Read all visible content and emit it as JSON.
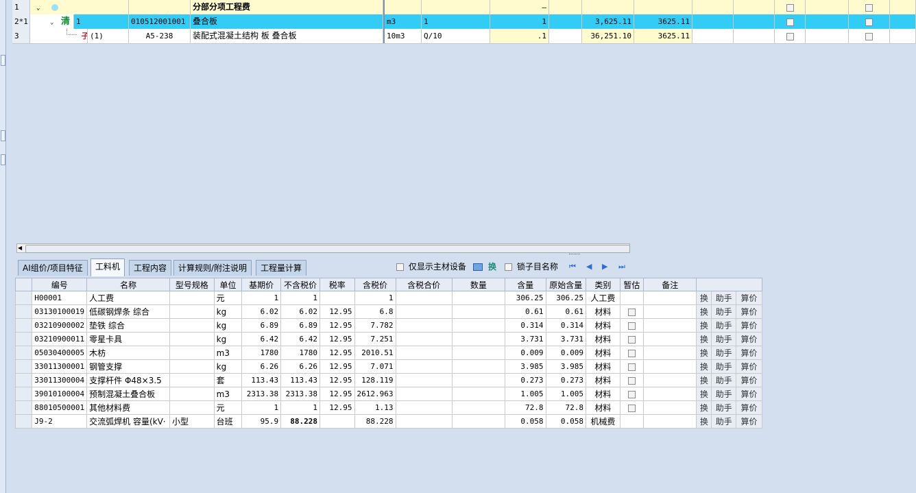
{
  "top_rows": [
    {
      "row": "1",
      "code": "",
      "name": "分部分项工程费",
      "unit": "",
      "expr": "",
      "qty": "–",
      "price": "",
      "total": ""
    },
    {
      "row": "2*1",
      "type": "清",
      "idx": "1",
      "code": "010512001001",
      "name": "叠合板",
      "unit": "m3",
      "expr": "1",
      "qty": "1",
      "price": "3,625.11",
      "total": "3625.11"
    },
    {
      "row": "3",
      "type": "子",
      "idx": "(1)",
      "code": "A5-238",
      "name": "装配式混凝土结构 板 叠合板",
      "unit": "10m3",
      "expr": "Q/10",
      "qty": ".1",
      "price": "36,251.10",
      "total": "3625.11"
    }
  ],
  "tabs": [
    "AI组价/项目特征",
    "工料机",
    "工程内容",
    "计算规则/附注说明",
    "工程量计算"
  ],
  "active_tab": 1,
  "toolbar": {
    "only_main_label": "仅显示主材设备",
    "swap_label": "换",
    "lock_name_label": "锁子目名称"
  },
  "columns": [
    "编号",
    "名称",
    "型号规格",
    "单位",
    "基期价",
    "不含税价",
    "税率",
    "含税价",
    "含税合价",
    "数量",
    "含量",
    "原始含量",
    "类别",
    "暂估",
    "备注"
  ],
  "row_buttons": [
    "换",
    "助手",
    "算价"
  ],
  "items": [
    {
      "code": "H00001",
      "name": "人工费",
      "spec": "",
      "unit": "元",
      "base": "1",
      "notax": "1",
      "tax": "",
      "withtax": "1",
      "content": "306.25",
      "orig": "306.25",
      "cat": "人工费",
      "est": false
    },
    {
      "code": "03130100019",
      "name": "低碳钢焊条 综合",
      "spec": "",
      "unit": "kg",
      "base": "6.02",
      "notax": "6.02",
      "tax": "12.95",
      "withtax": "6.8",
      "content": "0.61",
      "orig": "0.61",
      "cat": "材料",
      "est": true
    },
    {
      "code": "03210900002",
      "name": "垫铁 综合",
      "spec": "",
      "unit": "kg",
      "base": "6.89",
      "notax": "6.89",
      "tax": "12.95",
      "withtax": "7.782",
      "content": "0.314",
      "orig": "0.314",
      "cat": "材料",
      "est": true
    },
    {
      "code": "03210900011",
      "name": "零星卡具",
      "spec": "",
      "unit": "kg",
      "base": "6.42",
      "notax": "6.42",
      "tax": "12.95",
      "withtax": "7.251",
      "content": "3.731",
      "orig": "3.731",
      "cat": "材料",
      "est": true
    },
    {
      "code": "05030400005",
      "name": "木枋",
      "spec": "",
      "unit": "m3",
      "base": "1780",
      "notax": "1780",
      "tax": "12.95",
      "withtax": "2010.51",
      "content": "0.009",
      "orig": "0.009",
      "cat": "材料",
      "est": true
    },
    {
      "code": "33011300001",
      "name": "钢管支撑",
      "spec": "",
      "unit": "kg",
      "base": "6.26",
      "notax": "6.26",
      "tax": "12.95",
      "withtax": "7.071",
      "content": "3.985",
      "orig": "3.985",
      "cat": "材料",
      "est": true
    },
    {
      "code": "33011300004",
      "name": "支撑杆件 Φ48×3.5",
      "spec": "",
      "unit": "套",
      "base": "113.43",
      "notax": "113.43",
      "tax": "12.95",
      "withtax": "128.119",
      "content": "0.273",
      "orig": "0.273",
      "cat": "材料",
      "est": true
    },
    {
      "code": "39010100004",
      "name": "预制混凝土叠合板",
      "spec": "",
      "unit": "m3",
      "base": "2313.38",
      "notax": "2313.38",
      "tax": "12.95",
      "withtax": "2612.963",
      "content": "1.005",
      "orig": "1.005",
      "cat": "材料",
      "est": true
    },
    {
      "code": "88010500001",
      "name": "其他材料费",
      "spec": "",
      "unit": "元",
      "base": "1",
      "notax": "1",
      "tax": "12.95",
      "withtax": "1.13",
      "content": "72.8",
      "orig": "72.8",
      "cat": "材料",
      "est": true
    },
    {
      "code": "J9-2",
      "name": "交流弧焊机 容量(kV·",
      "spec": "小型",
      "unit": "台班",
      "base": "95.9",
      "notax": "88.228",
      "tax": "",
      "withtax": "88.228",
      "content": "0.058",
      "orig": "0.058",
      "cat": "机械费",
      "est": false
    }
  ],
  "colors": {
    "selected_row": "#33ccf5",
    "yellow_cell": "#fffbcf",
    "background": "#d3dfef"
  }
}
